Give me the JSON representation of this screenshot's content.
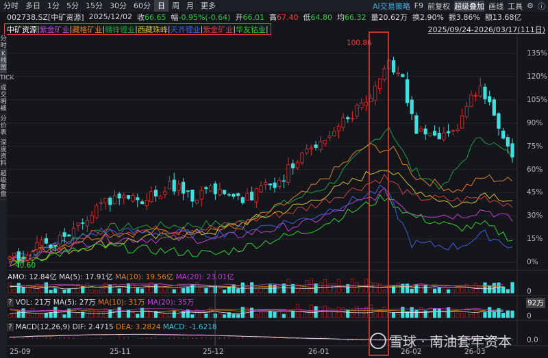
{
  "topbar": {
    "tabs": [
      "分时",
      "多日",
      "1分",
      "5分",
      "15分",
      "30分",
      "60分",
      "日",
      "周",
      "月",
      "更多"
    ],
    "active": "日",
    "right": [
      "AI交易策略",
      "F9",
      "前复权",
      "超级叠加",
      "画线",
      "工具"
    ]
  },
  "info": {
    "code": "002738.SZ[中矿资源]",
    "date": "2025/12/02",
    "close_label": "收",
    "close": "66.65",
    "chg_label": "幅",
    "chg": "-0.95%(-0.64)",
    "open_label": "开",
    "open": "66.01",
    "high_label": "高",
    "high": "67.40",
    "low_label": "低",
    "low": "64.80",
    "avg_label": "均",
    "avg": "66.32",
    "vol_label": "量",
    "vol": "20.62万",
    "turn_label": "换",
    "turn": "2.90%",
    "amp_label": "振",
    "amp": "3.86%",
    "amt_label": "额",
    "amt": "13.68亿"
  },
  "overlay": {
    "items": [
      {
        "name": "中矿资源",
        "color": "#ffffff"
      },
      {
        "name": "紫金矿业",
        "color": "#c040d0"
      },
      {
        "name": "藏格矿业",
        "color": "#e08020"
      },
      {
        "name": "赣锋锂业",
        "color": "#20a040"
      },
      {
        "name": "西藏珠峰",
        "color": "#d0c030"
      },
      {
        "name": "天齐锂业",
        "color": "#4060e0"
      },
      {
        "name": "紫金矿业",
        "color": "#d04040"
      },
      {
        "name": "华友钴业",
        "color": "#30d030"
      }
    ],
    "range": "2025/09/24-2026/03/17(111日)"
  },
  "sidebar": [
    "分时图",
    "K线图",
    "TICK",
    "成交明细",
    "分价表",
    "深度资料",
    "超级复盘"
  ],
  "chart": {
    "max_label": "100.86",
    "min_label": "40.60",
    "yticks": [
      "135%",
      "120%",
      "105%",
      "90%",
      "75%",
      "60%",
      "45%",
      "30%",
      "15%",
      "0%"
    ],
    "xticks": [
      "25-09",
      "25-11",
      "25-12",
      "26-01",
      "26-02",
      "26-03"
    ]
  },
  "amo": {
    "label": "AMO: 12.84亿",
    "ma5": "MA(5): 17.91亿",
    "ma10": "MA(10): 19.56亿",
    "ma20": "MA(20): 23.01亿",
    "axis": "0"
  },
  "vol": {
    "q": "?",
    "label": "VOL: 21万",
    "ma5": "MA(5): 27万",
    "ma10": "MA(10): 31万",
    "ma20": "MA(20): 35万",
    "axis_top": "92万",
    "axis": "0"
  },
  "macd": {
    "q": "?",
    "label": "MACD(12,26,9)",
    "dif": "DIF: 2.4715",
    "dea": "DEA: 3.2824",
    "macd": "MACD: -1.6218",
    "axis": "0.0"
  },
  "watermark": "雪球 · 南油套牢资本",
  "chart_data": {
    "type": "candlestick",
    "days": 111,
    "main_pct_keypoints": [
      [
        0,
        2
      ],
      [
        5,
        8
      ],
      [
        10,
        14
      ],
      [
        15,
        22
      ],
      [
        20,
        36
      ],
      [
        25,
        44
      ],
      [
        30,
        40
      ],
      [
        35,
        50
      ],
      [
        40,
        42
      ],
      [
        45,
        48
      ],
      [
        50,
        40
      ],
      [
        55,
        46
      ],
      [
        60,
        56
      ],
      [
        65,
        72
      ],
      [
        70,
        84
      ],
      [
        75,
        96
      ],
      [
        80,
        112
      ],
      [
        83,
        128
      ],
      [
        86,
        118
      ],
      [
        89,
        84
      ],
      [
        94,
        80
      ],
      [
        99,
        92
      ],
      [
        103,
        118
      ],
      [
        106,
        92
      ],
      [
        110,
        72
      ]
    ],
    "compare": [
      {
        "name": "赣锋锂业",
        "color": "#20a040",
        "pts": [
          [
            0,
            0
          ],
          [
            20,
            22
          ],
          [
            50,
            25
          ],
          [
            70,
            50
          ],
          [
            83,
            88
          ],
          [
            88,
            60
          ],
          [
            95,
            48
          ],
          [
            103,
            82
          ],
          [
            110,
            68
          ]
        ]
      },
      {
        "name": "藏格矿业",
        "color": "#e08020",
        "pts": [
          [
            0,
            2
          ],
          [
            20,
            18
          ],
          [
            50,
            22
          ],
          [
            65,
            45
          ],
          [
            78,
            75
          ],
          [
            84,
            72
          ],
          [
            89,
            55
          ],
          [
            98,
            46
          ],
          [
            104,
            55
          ],
          [
            110,
            52
          ]
        ]
      },
      {
        "name": "西藏珠峰",
        "color": "#d0c030",
        "pts": [
          [
            0,
            0
          ],
          [
            20,
            12
          ],
          [
            45,
            20
          ],
          [
            65,
            38
          ],
          [
            82,
            62
          ],
          [
            88,
            48
          ],
          [
            98,
            36
          ],
          [
            104,
            45
          ],
          [
            110,
            40
          ]
        ]
      },
      {
        "name": "紫金矿业",
        "color": "#d04040",
        "pts": [
          [
            0,
            0
          ],
          [
            20,
            20
          ],
          [
            45,
            22
          ],
          [
            65,
            35
          ],
          [
            82,
            55
          ],
          [
            88,
            42
          ],
          [
            98,
            40
          ],
          [
            104,
            42
          ],
          [
            110,
            37
          ]
        ]
      },
      {
        "name": "紫金矿业",
        "color": "#c040d0",
        "pts": [
          [
            0,
            0
          ],
          [
            20,
            15
          ],
          [
            45,
            15
          ],
          [
            65,
            25
          ],
          [
            82,
            45
          ],
          [
            88,
            32
          ],
          [
            98,
            30
          ],
          [
            104,
            34
          ],
          [
            110,
            27
          ]
        ]
      },
      {
        "name": "华友钴业",
        "color": "#30d030",
        "pts": [
          [
            0,
            0
          ],
          [
            20,
            10
          ],
          [
            45,
            5
          ],
          [
            65,
            20
          ],
          [
            82,
            42
          ],
          [
            88,
            30
          ],
          [
            98,
            22
          ],
          [
            104,
            24
          ],
          [
            110,
            15
          ]
        ]
      },
      {
        "name": "天齐锂业",
        "color": "#4060e0",
        "pts": [
          [
            0,
            2
          ],
          [
            20,
            20
          ],
          [
            45,
            18
          ],
          [
            65,
            28
          ],
          [
            82,
            48
          ],
          [
            88,
            12
          ],
          [
            98,
            10
          ],
          [
            104,
            18
          ],
          [
            110,
            10
          ]
        ]
      }
    ]
  }
}
